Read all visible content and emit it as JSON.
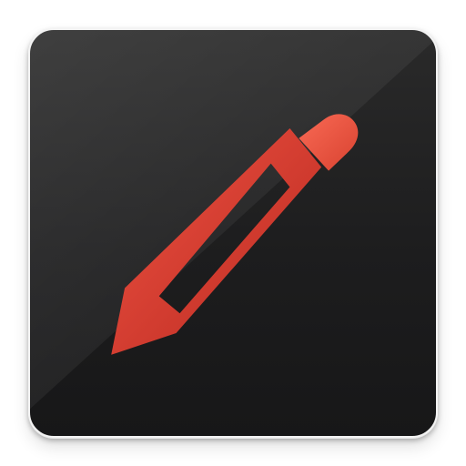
{
  "icon": {
    "name": "pencil-icon",
    "tile_color": "#1d1d1e",
    "accent_color": "#e44538",
    "accent_dark_color": "#b92a21",
    "cap_color": "#f05a45"
  }
}
